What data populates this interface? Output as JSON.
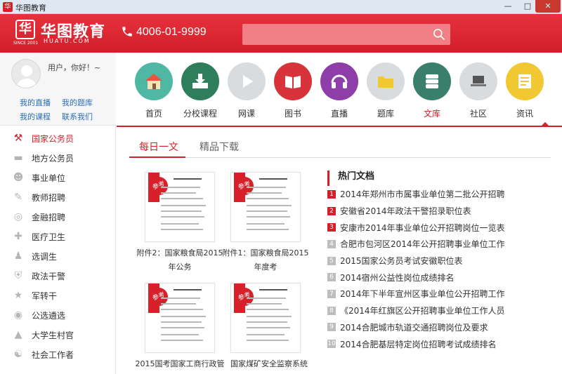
{
  "window": {
    "title": "华图教育"
  },
  "header": {
    "logo_text": "华图教育",
    "logo_sub": "HUATU.COM",
    "logo_since": "SINCE 2001",
    "phone": "4006-01-9999",
    "search_placeholder": ""
  },
  "user": {
    "greeting": "用户，你好！~",
    "links": [
      "我的直播",
      "我的题库",
      "我的课程",
      "联系我们"
    ]
  },
  "categories": [
    {
      "label": "国家公务员",
      "icon": "party-emblem-icon",
      "active": true
    },
    {
      "label": "地方公务员",
      "icon": "hat-icon"
    },
    {
      "label": "事业单位",
      "icon": "group-icon"
    },
    {
      "label": "教师招聘",
      "icon": "teacher-icon"
    },
    {
      "label": "金融招聘",
      "icon": "coin-icon"
    },
    {
      "label": "医疗卫生",
      "icon": "medical-cross-icon"
    },
    {
      "label": "选调生",
      "icon": "person-icon"
    },
    {
      "label": "政法干警",
      "icon": "badge-icon"
    },
    {
      "label": "军转干",
      "icon": "star-icon"
    },
    {
      "label": "公选遴选",
      "icon": "chat-icon"
    },
    {
      "label": "大学生村官",
      "icon": "mountain-icon"
    },
    {
      "label": "社会工作者",
      "icon": "handshake-icon"
    }
  ],
  "nav": [
    {
      "label": "首页",
      "icon": "home-icon",
      "color": "#4fb8a4"
    },
    {
      "label": "分校课程",
      "icon": "download-course-icon",
      "color": "#2e7d5b"
    },
    {
      "label": "网课",
      "icon": "play-icon",
      "color": "#d9dcdf"
    },
    {
      "label": "图书",
      "icon": "book-icon",
      "color": "#d8323a"
    },
    {
      "label": "直播",
      "icon": "headphone-icon",
      "color": "#8e3ea8"
    },
    {
      "label": "题库",
      "icon": "folder-icon",
      "color": "#d9dcdf"
    },
    {
      "label": "文库",
      "icon": "database-icon",
      "color": "#3a7f6b",
      "active": true
    },
    {
      "label": "社区",
      "icon": "laptop-icon",
      "color": "#d9dcdf"
    },
    {
      "label": "资讯",
      "icon": "news-icon",
      "color": "#f2c832"
    }
  ],
  "tabs": {
    "daily": "每日一文",
    "premium": "精品下载"
  },
  "docs": [
    {
      "caption": "附件2：国家粮食局2015年公务",
      "badge": "参考"
    },
    {
      "caption": "附件1：国家粮食局2015年度考",
      "badge": "参考"
    },
    {
      "caption": "2015国考国家工商行政管",
      "badge": "参考"
    },
    {
      "caption": "国家煤矿安全监察系统",
      "badge": "参考"
    }
  ],
  "hot": {
    "title": "热门文档",
    "items": [
      "2014年郑州市市属事业单位第二批公开招聘",
      "安徽省2014年政法干警招录职位表",
      "安康市2014年事业单位公开招聘岗位一览表",
      "合肥市包河区2014年公开招聘事业单位工作",
      "2015国家公务员考试安徽职位表",
      "2014宿州公益性岗位成绩排名",
      "2014年下半年宣州区事业单位公开招聘工作",
      "《2014年红旗区公开招聘事业单位工作人员",
      "2014合肥城市轨道交通招聘岗位及要求",
      "2014合肥基层特定岗位招聘考试成绩排名"
    ]
  }
}
